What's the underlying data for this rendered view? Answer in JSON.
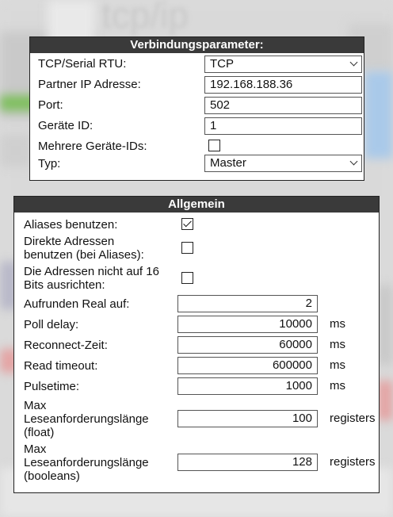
{
  "background": {
    "watermark": "tcp/ip"
  },
  "connection": {
    "title": "Verbindungsparameter:",
    "protocol_label": "TCP/Serial RTU:",
    "protocol_value": "TCP",
    "ip_label": "Partner IP Adresse:",
    "ip_value": "192.168.188.36",
    "port_label": "Port:",
    "port_value": "502",
    "device_id_label": "Geräte ID:",
    "device_id_value": "1",
    "multi_ids_label": "Mehrere Geräte-IDs:",
    "multi_ids_checked": false,
    "type_label": "Typ:",
    "type_value": "Master"
  },
  "general": {
    "title": "Allgemein",
    "aliases_label": "Aliases benutzen:",
    "aliases_checked": true,
    "direct_label_1": "Direkte Adressen",
    "direct_label_2": "benutzen (bei Aliases):",
    "direct_checked": false,
    "align_label_1": "Die Adressen nicht auf 16",
    "align_label_2": "Bits ausrichten:",
    "align_checked": false,
    "round_label": "Aufrunden Real auf:",
    "round_value": "2",
    "poll_label": "Poll delay:",
    "poll_value": "10000",
    "poll_unit": "ms",
    "reconnect_label": "Reconnect-Zeit:",
    "reconnect_value": "60000",
    "reconnect_unit": "ms",
    "timeout_label": "Read timeout:",
    "timeout_value": "600000",
    "timeout_unit": "ms",
    "pulse_label": "Pulsetime:",
    "pulse_value": "1000",
    "pulse_unit": "ms",
    "maxfloat_label_1": "Max",
    "maxfloat_label_2": "Leseanforderungslänge",
    "maxfloat_label_3": "(float)",
    "maxfloat_value": "100",
    "maxfloat_unit": "registers",
    "maxbool_label_1": "Max",
    "maxbool_label_2": "Leseanforderungslänge",
    "maxbool_label_3": "(booleans)",
    "maxbool_value": "128",
    "maxbool_unit": "registers"
  }
}
